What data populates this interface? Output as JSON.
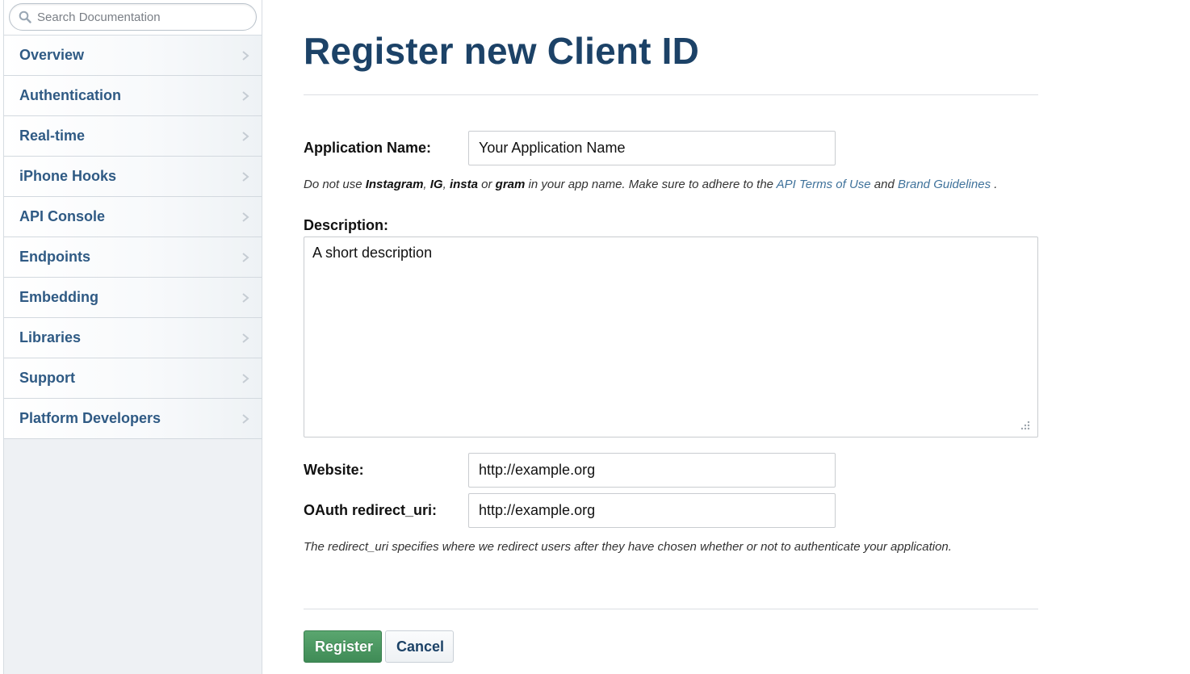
{
  "sidebar": {
    "search": {
      "placeholder": "Search Documentation",
      "icon": "search-icon"
    },
    "items": [
      {
        "label": "Overview"
      },
      {
        "label": "Authentication"
      },
      {
        "label": "Real-time"
      },
      {
        "label": "iPhone Hooks"
      },
      {
        "label": "API Console"
      },
      {
        "label": "Endpoints"
      },
      {
        "label": "Embedding"
      },
      {
        "label": "Libraries"
      },
      {
        "label": "Support"
      },
      {
        "label": "Platform Developers"
      }
    ]
  },
  "main": {
    "title": "Register new Client ID",
    "form": {
      "app_name": {
        "label": "Application Name:",
        "value": "Your Application Name"
      },
      "name_hint": {
        "t1": "Do not use ",
        "b1": "Instagram",
        "t2": ", ",
        "b2": "IG",
        "t3": ", ",
        "b3": "insta",
        "t4": " or ",
        "b4": "gram",
        "t5": " in your app name. Make sure to adhere to the ",
        "link1": "API Terms of Use",
        "t6": " and ",
        "link2": "Brand Guidelines",
        "t7": " ."
      },
      "description": {
        "label": "Description:",
        "value": "A short description"
      },
      "website": {
        "label": "Website:",
        "value": "http://example.org"
      },
      "redirect_uri": {
        "label": "OAuth redirect_uri:",
        "value": "http://example.org"
      },
      "redirect_hint": "The redirect_uri specifies where we redirect users after they have chosen whether or not to authenticate your application."
    },
    "buttons": {
      "register": "Register",
      "cancel": "Cancel"
    }
  },
  "colors": {
    "title": "#1c4267",
    "nav_text": "#2f5a84",
    "link": "#3f729b",
    "register_button": "#4a9862",
    "sidebar_bg": "#eef1f4"
  }
}
